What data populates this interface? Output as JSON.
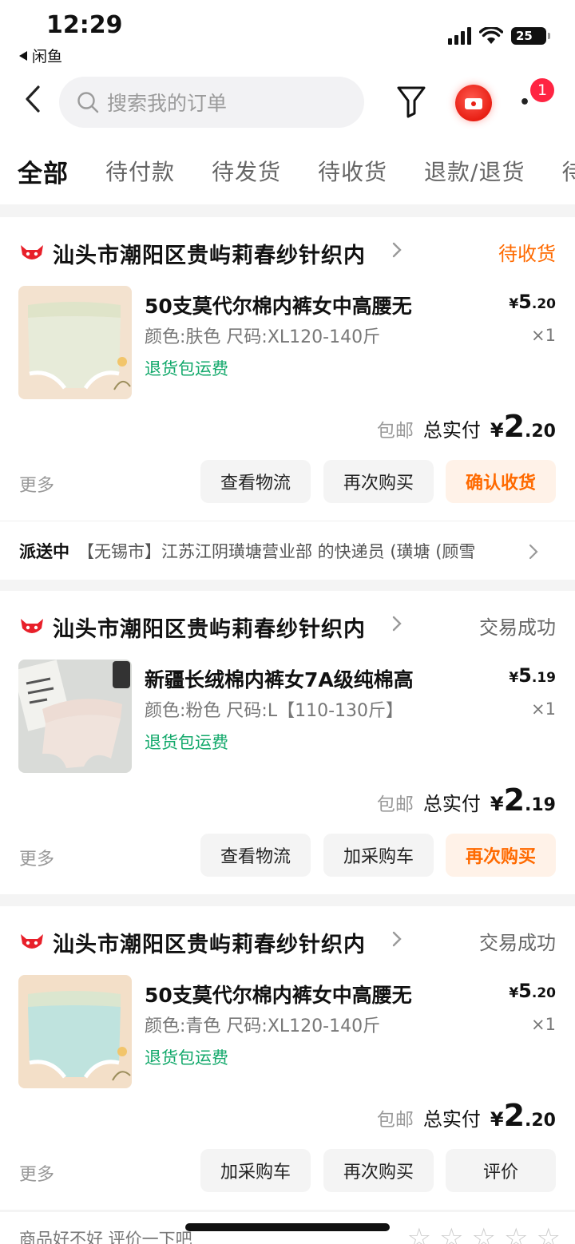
{
  "status_bar": {
    "time": "12:29",
    "back_app": "闲鱼",
    "battery": "25"
  },
  "search": {
    "placeholder": "搜索我的订单"
  },
  "notifications": {
    "count": "1"
  },
  "tabs": [
    "全部",
    "待付款",
    "待发货",
    "待收货",
    "退款/退货",
    "待评价"
  ],
  "orders": [
    {
      "shop": "汕头市潮阳区贵屿莉春纱针织内",
      "status": "待收货",
      "title": "50支莫代尔棉内裤女中高腰无",
      "spec": "颜色:肤色 尺码:XL120-140斤",
      "tag": "退货包运费",
      "unit_price_int": "5",
      "unit_price_dec": ".20",
      "qty": "×1",
      "shipping": "包邮",
      "total_label": "总实付",
      "total_int": "2",
      "total_dec": ".20",
      "more": "更多",
      "buttons": [
        "查看物流",
        "再次购买",
        "确认收货"
      ],
      "delivery_status": "派送中",
      "delivery_text": "【无锡市】江苏江阴璜塘营业部 的快递员 (璜塘 (顾雪"
    },
    {
      "shop": "汕头市潮阳区贵屿莉春纱针织内",
      "status": "交易成功",
      "title": "新疆长绒棉内裤女7A级纯棉高",
      "spec": "颜色:粉色 尺码:L【110-130斤】",
      "tag": "退货包运费",
      "unit_price_int": "5",
      "unit_price_dec": ".19",
      "qty": "×1",
      "shipping": "包邮",
      "total_label": "总实付",
      "total_int": "2",
      "total_dec": ".19",
      "more": "更多",
      "buttons": [
        "查看物流",
        "加采购车",
        "再次购买"
      ]
    },
    {
      "shop": "汕头市潮阳区贵屿莉春纱针织内",
      "status": "交易成功",
      "title": "50支莫代尔棉内裤女中高腰无",
      "spec": "颜色:青色 尺码:XL120-140斤",
      "tag": "退货包运费",
      "unit_price_int": "5",
      "unit_price_dec": ".20",
      "qty": "×1",
      "shipping": "包邮",
      "total_label": "总实付",
      "total_int": "2",
      "total_dec": ".20",
      "more": "更多",
      "buttons": [
        "加采购车",
        "再次购买",
        "评价"
      ]
    }
  ],
  "review_prompt": "商品好不好 评价一下吧",
  "colors": {
    "accent": "#ff6a00",
    "tag_green": "#11a86a",
    "badge_red": "#ff2442",
    "tmall_red": "#e8202a"
  },
  "currency": "¥"
}
